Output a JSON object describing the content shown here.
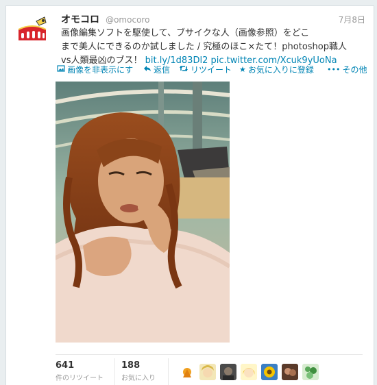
{
  "tweet": {
    "display_name": "オモコロ",
    "handle": "@omocoro",
    "date": "7月8日",
    "text_line1": "画像編集ソフトを駆使して、ブサイクな人（画像参照）をどこ",
    "text_line2": "まで美人にできるのか試しました / 究極のほこ×たて！photoshop職人",
    "text_line3_prefix": "vs人類最凶のブス！ ",
    "link1": "bit.ly/1d83Dl2",
    "link2": "pic.twitter.com/Xcuk9yUoNa"
  },
  "actions": {
    "hide_image": "画像を非表示にす",
    "reply": "返信",
    "retweet": "リツイート",
    "favorite": "お気に入りに登録",
    "more": "その他"
  },
  "stats": {
    "retweets_count": "641",
    "retweets_label": "件のリツイート",
    "favorites_count": "188",
    "favorites_label": "お気に入り"
  },
  "colors": {
    "link": "#0084b4",
    "name": "#222222",
    "meta": "#999999"
  },
  "icons": {
    "hide_image": "image-icon",
    "reply": "reply-arrow-icon",
    "retweet": "retweet-icon",
    "favorite": "star-icon",
    "more": "ellipsis-icon"
  }
}
